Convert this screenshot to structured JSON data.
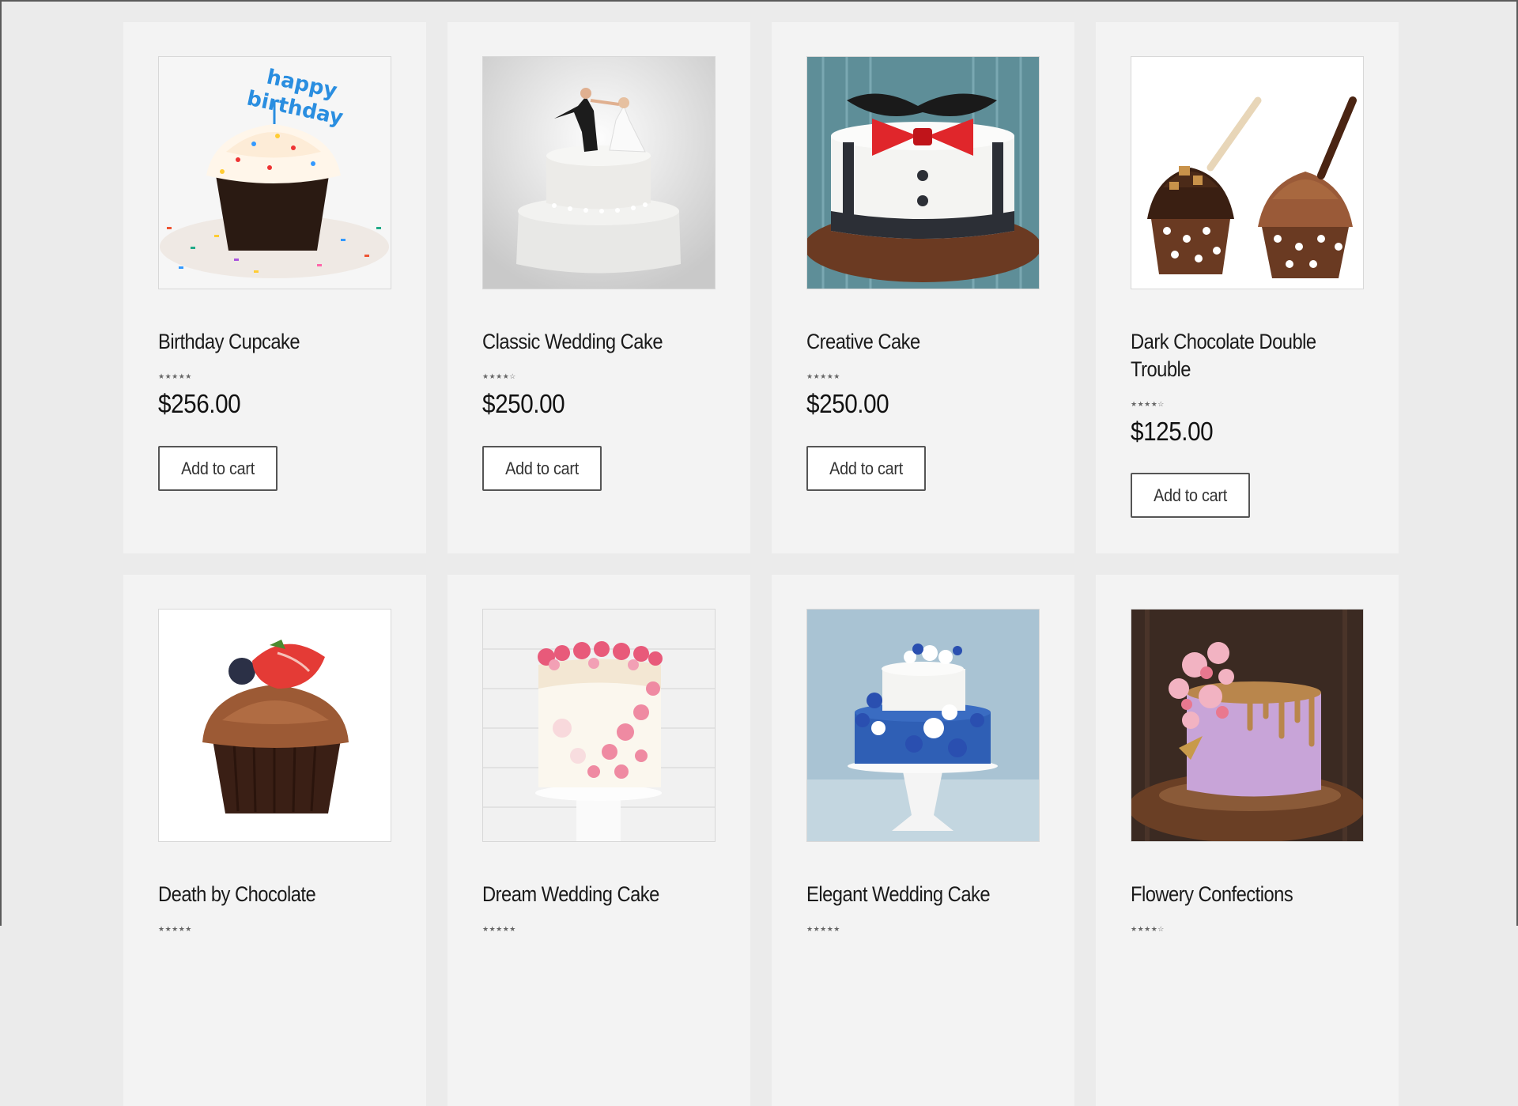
{
  "products": [
    {
      "name": "Birthday Cupcake",
      "rating": 5,
      "price": "$256.00",
      "button": "Add to cart",
      "image": "birthday-cupcake-image"
    },
    {
      "name": "Classic Wedding Cake",
      "rating": 4,
      "price": "$250.00",
      "button": "Add to cart",
      "image": "wedding-cake-image"
    },
    {
      "name": "Creative Cake",
      "rating": 5,
      "price": "$250.00",
      "button": "Add to cart",
      "image": "bowtie-cake-image"
    },
    {
      "name": "Dark Chocolate Double Trouble",
      "rating": 4,
      "price": "$125.00",
      "button": "Add to cart",
      "image": "chocolate-cupcakes-image"
    },
    {
      "name": "Death by Chocolate",
      "rating": 5,
      "price": "",
      "button": "",
      "image": "strawberry-cupcake-image"
    },
    {
      "name": "Dream Wedding Cake",
      "rating": 5,
      "price": "",
      "button": "",
      "image": "floral-cake-image"
    },
    {
      "name": "Elegant Wedding Cake",
      "rating": 5,
      "price": "",
      "button": "",
      "image": "blue-wedding-cake-image"
    },
    {
      "name": "Flowery Confections",
      "rating": 4,
      "price": "",
      "button": "",
      "image": "drip-cake-image"
    }
  ],
  "topper_text": [
    "happy",
    "birthday"
  ],
  "colors": {
    "page_bg": "#ebebeb",
    "card_bg": "#f3f3f3",
    "button_border": "#555555",
    "star": "#666666"
  }
}
